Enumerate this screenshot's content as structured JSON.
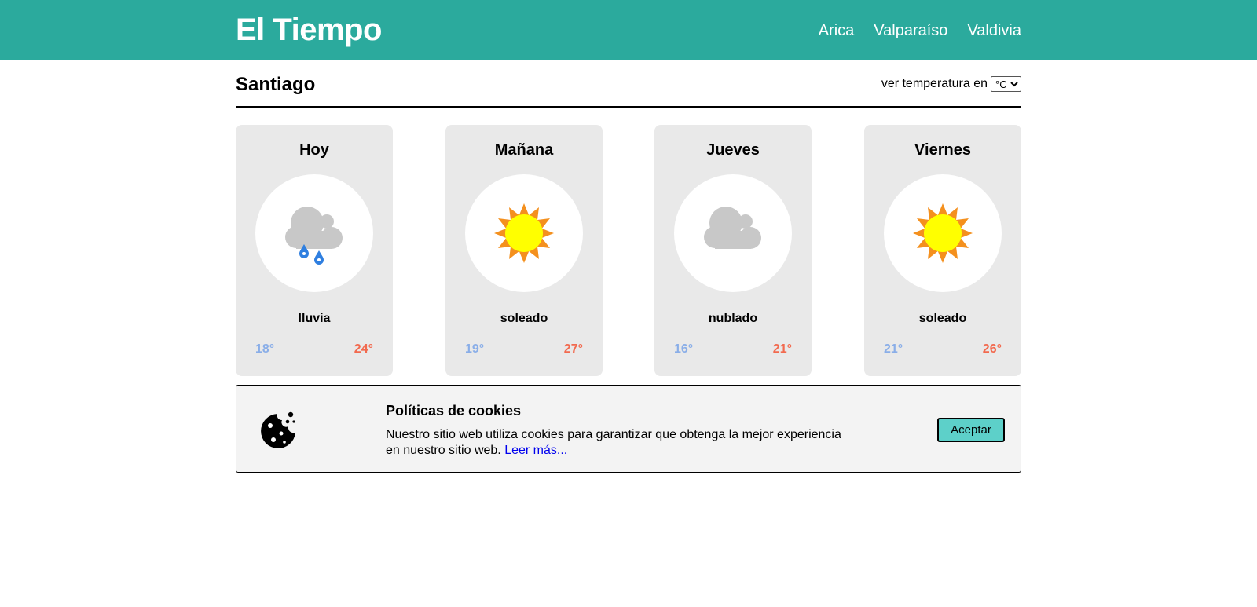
{
  "header": {
    "brand": "El Tiempo",
    "nav": [
      "Arica",
      "Valparaíso",
      "Valdivia"
    ],
    "background_color": "#2baa9d"
  },
  "location": {
    "city": "Santiago",
    "unit_label": "ver temperatura en",
    "unit_selected": "°C"
  },
  "forecast": [
    {
      "day": "Hoy",
      "condition": "lluvia",
      "icon": "rain-cloud-icon",
      "min": "18°",
      "max": "24°"
    },
    {
      "day": "Mañana",
      "condition": "soleado",
      "icon": "sun-icon",
      "min": "19°",
      "max": "27°"
    },
    {
      "day": "Jueves",
      "condition": "nublado",
      "icon": "cloud-icon",
      "min": "16°",
      "max": "21°"
    },
    {
      "day": "Viernes",
      "condition": "soleado",
      "icon": "sun-icon",
      "min": "21°",
      "max": "26°"
    }
  ],
  "colors": {
    "min_temp": "#8aaee8",
    "max_temp": "#f26a4f",
    "card_bg": "#e9e9e9",
    "accept_button": "#5dd0c9"
  },
  "cookies": {
    "icon": "cookie-icon",
    "title": "Políticas de cookies",
    "text": "Nuestro sitio web utiliza cookies para garantizar que obtenga la mejor experiencia en nuestro sitio web.",
    "link": "Leer más...",
    "accept": "Aceptar"
  }
}
